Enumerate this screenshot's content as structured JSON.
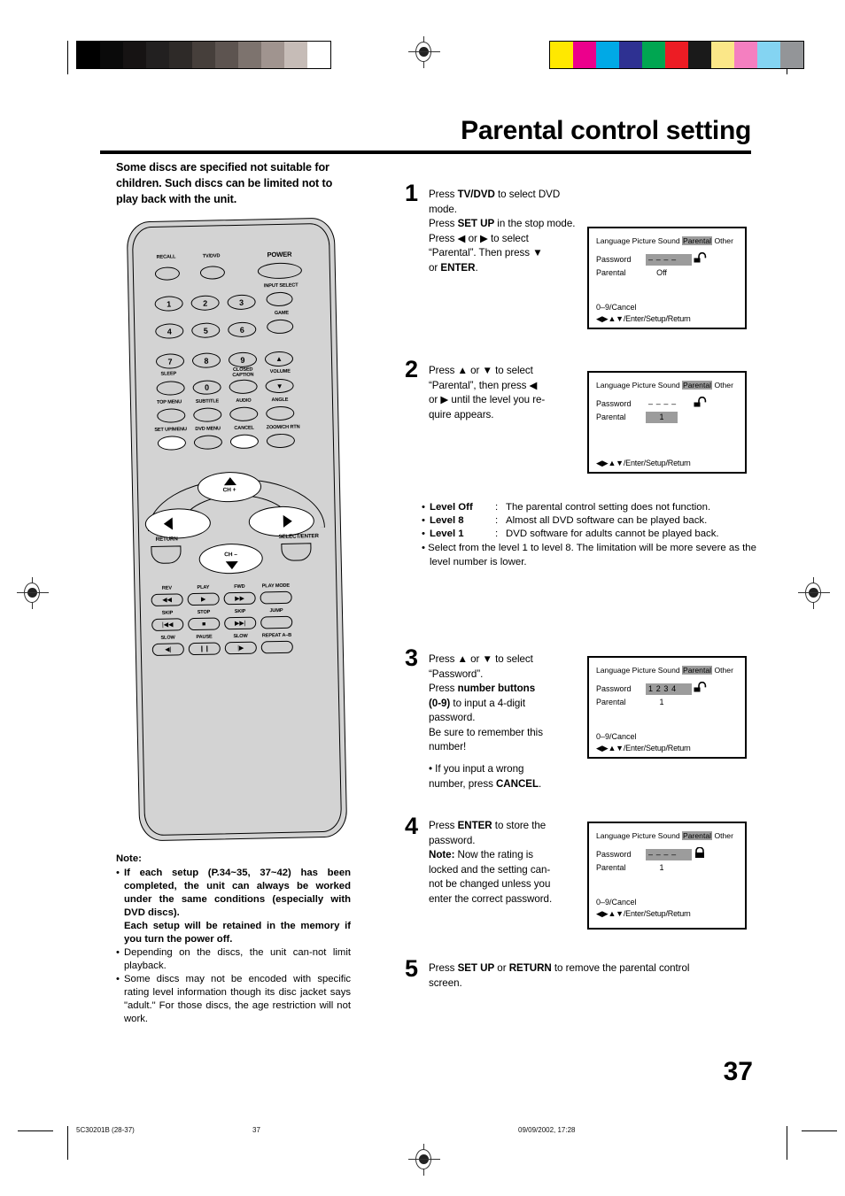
{
  "document": {
    "title": "Parental control setting",
    "page_number": "37",
    "lead_text": "Some discs are specified not suitable for children. Such discs can be limited not to play back with the unit."
  },
  "footer": {
    "doc_code": "5C30201B (28-37)",
    "page": "37",
    "timestamp": "09/09/2002, 17:28"
  },
  "steps": [
    {
      "number": "1",
      "lines": [
        [
          {
            "t": "Press ",
            "b": false
          },
          {
            "t": "TV/DVD",
            "b": true
          },
          {
            "t": " to select DVD mode.",
            "b": false
          }
        ],
        [
          {
            "t": "Press ",
            "b": false
          },
          {
            "t": "SET UP",
            "b": true
          },
          {
            "t": " in the stop mode.",
            "b": false
          }
        ],
        [
          {
            "t": "Press ◀ or ▶ to select",
            "b": false
          }
        ],
        [
          {
            "t": "“Parental”. Then press ▼",
            "b": false
          }
        ],
        [
          {
            "t": "or ",
            "b": false
          },
          {
            "t": "ENTER",
            "b": true
          },
          {
            "t": ".",
            "b": false
          }
        ]
      ]
    },
    {
      "number": "2",
      "lines": [
        [
          {
            "t": "Press ▲ or ▼ to select",
            "b": false
          }
        ],
        [
          {
            "t": "“Parental”, then press ◀",
            "b": false
          }
        ],
        [
          {
            "t": "or ▶ until the level you re-",
            "b": false
          }
        ],
        [
          {
            "t": "quire appears.",
            "b": false
          }
        ]
      ]
    },
    {
      "number": "3",
      "lines": [
        [
          {
            "t": "Press ▲ or ▼ to select",
            "b": false
          }
        ],
        [
          {
            "t": "“Password”.",
            "b": false
          }
        ],
        [
          {
            "t": "Press ",
            "b": false
          },
          {
            "t": "number buttons",
            "b": true
          }
        ],
        [
          {
            "t": "(0-9)",
            "b": true
          },
          {
            "t": " to input a 4-digit",
            "b": false
          }
        ],
        [
          {
            "t": "password.",
            "b": false
          }
        ],
        [
          {
            "t": "Be sure to remember this",
            "b": false
          }
        ],
        [
          {
            "t": "number!",
            "b": false
          }
        ]
      ],
      "sub_bullet": [
        [
          {
            "t": "• If you input a wrong",
            "b": false
          }
        ],
        [
          {
            "t": "  number, press ",
            "b": false
          },
          {
            "t": "CANCEL",
            "b": true
          },
          {
            "t": ".",
            "b": false
          }
        ]
      ]
    },
    {
      "number": "4",
      "lines": [
        [
          {
            "t": "Press ",
            "b": false
          },
          {
            "t": "ENTER",
            "b": true
          },
          {
            "t": " to store the",
            "b": false
          }
        ],
        [
          {
            "t": "password.",
            "b": false
          }
        ],
        [
          {
            "t": "Note:",
            "b": true
          },
          {
            "t": " Now the rating is",
            "b": false
          }
        ],
        [
          {
            "t": "locked and the setting can-",
            "b": false
          }
        ],
        [
          {
            "t": "not be changed unless you",
            "b": false
          }
        ],
        [
          {
            "t": "enter the correct password.",
            "b": false
          }
        ]
      ]
    },
    {
      "number": "5",
      "lines": [
        [
          {
            "t": "Press ",
            "b": false
          },
          {
            "t": "SET UP",
            "b": true
          },
          {
            "t": " or ",
            "b": false
          },
          {
            "t": "RETURN",
            "b": true
          },
          {
            "t": " to remove the parental control",
            "b": false
          }
        ],
        [
          {
            "t": "screen.",
            "b": false
          }
        ]
      ]
    }
  ],
  "levels": {
    "items": [
      {
        "bullet": "•",
        "name": "Level Off",
        "colon": ":",
        "desc": "The parental control setting does not function."
      },
      {
        "bullet": "•",
        "name": "Level 8",
        "colon": ":",
        "desc": "Almost all DVD software can be played back."
      },
      {
        "bullet": "•",
        "name": "Level 1",
        "colon": ":",
        "desc": "DVD software for adults cannot be played back."
      }
    ],
    "note": "• Select from the level 1 to level 8. The limitation will be more severe as the level number is lower."
  },
  "osd_screens": [
    {
      "id": "osd-step-1",
      "tabs": [
        "Language",
        "Picture",
        "Sound",
        "Parental",
        "Other"
      ],
      "highlighted_tab": "Parental",
      "rows": [
        {
          "label": "Password",
          "value": "– – – –",
          "highlighted": true,
          "lock": "open"
        },
        {
          "label": "Parental",
          "value": "Off",
          "highlighted": false
        }
      ],
      "footer1": "0–9/Cancel",
      "footer2": "◀▶▲▼/Enter/Setup/Return"
    },
    {
      "id": "osd-step-2",
      "tabs": [
        "Language",
        "Picture",
        "Sound",
        "Parental",
        "Other"
      ],
      "highlighted_tab": "Parental",
      "rows": [
        {
          "label": "Password",
          "value": "– – – –",
          "highlighted": false,
          "lock": "open"
        },
        {
          "label": "Parental",
          "value": "1",
          "highlighted": true
        }
      ],
      "footer1": "",
      "footer2": "◀▶▲▼/Enter/Setup/Return"
    },
    {
      "id": "osd-step-3",
      "tabs": [
        "Language",
        "Picture",
        "Sound",
        "Parental",
        "Other"
      ],
      "highlighted_tab": "Parental",
      "rows": [
        {
          "label": "Password",
          "value": "1 2 3 4",
          "highlighted": true,
          "lock": "open"
        },
        {
          "label": "Parental",
          "value": "1",
          "highlighted": false
        }
      ],
      "footer1": "0–9/Cancel",
      "footer2": "◀▶▲▼/Enter/Setup/Return"
    },
    {
      "id": "osd-step-4",
      "tabs": [
        "Language",
        "Picture",
        "Sound",
        "Parental",
        "Other"
      ],
      "highlighted_tab": "Parental",
      "rows": [
        {
          "label": "Password",
          "value": "– – – –",
          "highlighted": true,
          "lock": "closed"
        },
        {
          "label": "Parental",
          "value": "1",
          "highlighted": false
        }
      ],
      "footer1": "0–9/Cancel",
      "footer2": "◀▶▲▼/Enter/Setup/Return"
    }
  ],
  "note": {
    "heading": "Note:",
    "items": [
      {
        "bullet": "•",
        "bold": true,
        "text": "If each setup (P.34~35, 37~42) has been  completed, the unit can always be worked under the same conditions (especially with DVD discs)."
      },
      {
        "bullet": "",
        "bold": true,
        "text": "Each setup will be retained in the memory if you turn the power off."
      },
      {
        "bullet": "•",
        "bold": false,
        "text": "Depending on the discs, the unit can-not limit playback."
      },
      {
        "bullet": "•",
        "bold": false,
        "text": "Some discs may not be encoded with specific rating level information though its disc jacket says \"adult.\" For those discs, the age restriction will not work."
      }
    ]
  },
  "remote": {
    "row_labels_top": [
      "RECALL",
      "TV/DVD",
      "POWER"
    ],
    "side_labels": [
      "INPUT SELECT",
      "GAME"
    ],
    "number_keys": [
      "1",
      "2",
      "3",
      "4",
      "5",
      "6",
      "7",
      "8",
      "9",
      "0"
    ],
    "labels": [
      "SLEEP",
      "CLOSED CAPTION",
      "VOLUME",
      "TOP MENU",
      "SUBTITLE",
      "AUDIO",
      "ANGLE",
      "SET UP/MENU",
      "DVD MENU",
      "CANCEL",
      "ZOOM/CH RTN"
    ],
    "nav": {
      "up": "CH +",
      "down": "CH –",
      "return": "RETURN",
      "select": "SELECT/ENTER"
    },
    "transport": [
      {
        "label": "REV",
        "glyph": "◀◀"
      },
      {
        "label": "PLAY",
        "glyph": "▶"
      },
      {
        "label": "FWD",
        "glyph": "▶▶"
      },
      {
        "label": "PLAY MODE",
        "glyph": ""
      },
      {
        "label": "SKIP",
        "glyph": "|◀◀"
      },
      {
        "label": "STOP",
        "glyph": "■"
      },
      {
        "label": "SKIP",
        "glyph": "▶▶|"
      },
      {
        "label": "JUMP",
        "glyph": ""
      },
      {
        "label": "SLOW",
        "glyph": "◀|"
      },
      {
        "label": "PAUSE",
        "glyph": "❙❙"
      },
      {
        "label": "SLOW",
        "glyph": "|▶"
      },
      {
        "label": "REPEAT A–B",
        "glyph": ""
      }
    ]
  },
  "colors": {
    "grayscale_bar": [
      "#000000",
      "#0a0a0a",
      "#161313",
      "#222020",
      "#2e2a28",
      "#463f3b",
      "#5d5450",
      "#7d736e",
      "#a0948f",
      "#c6bcb7",
      "#ffffff"
    ],
    "color_bar": [
      "#ffe800",
      "#ec008c",
      "#00a9e6",
      "#2e3192",
      "#00a651",
      "#ed1c24",
      "#1a1a1a",
      "#fbe788",
      "#f47fc0",
      "#84d4f2",
      "#939598"
    ],
    "osd_highlight": "#9c9c9c",
    "remote_body": "#d3d3d3"
  }
}
